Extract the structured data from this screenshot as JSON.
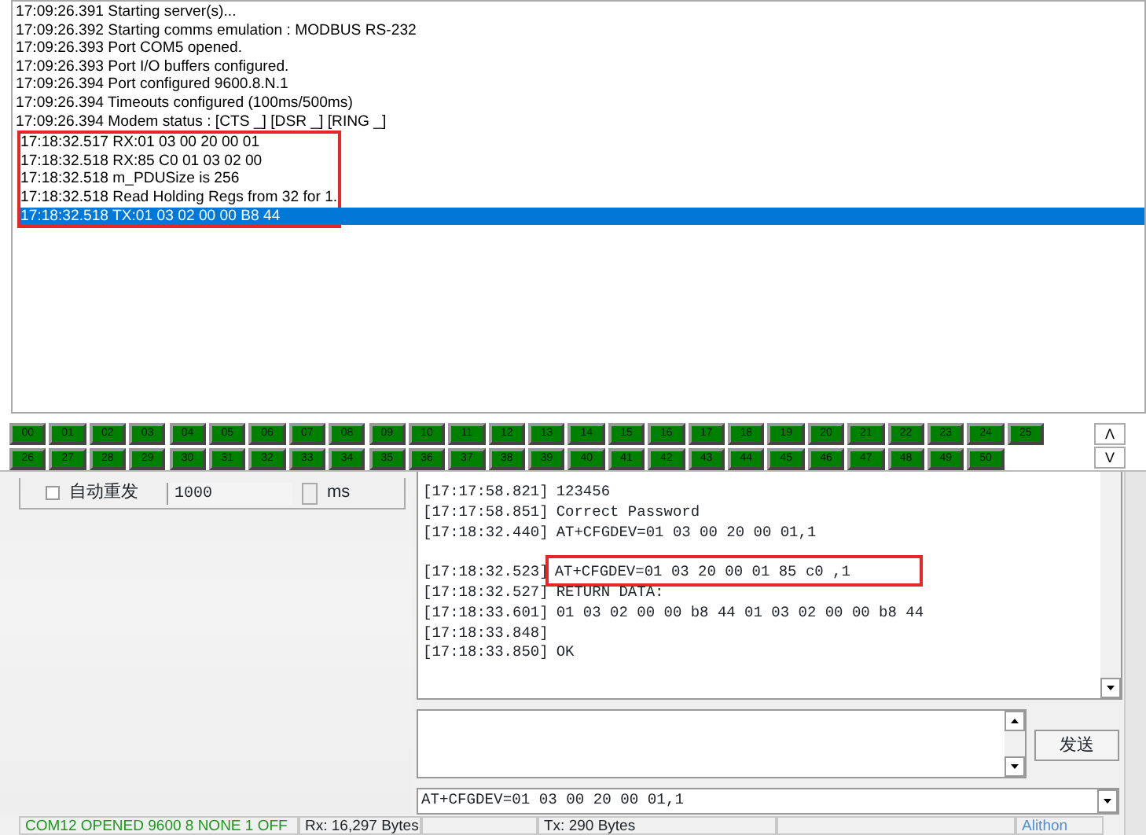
{
  "log_window": {
    "lines": [
      {
        "text": "17:09:26.391 Starting server(s)...",
        "selected": false,
        "annotated": false
      },
      {
        "text": "17:09:26.392 Starting comms emulation : MODBUS RS-232",
        "selected": false,
        "annotated": false
      },
      {
        "text": "17:09:26.393 Port COM5 opened.",
        "selected": false,
        "annotated": false
      },
      {
        "text": "17:09:26.393 Port I/O buffers configured.",
        "selected": false,
        "annotated": false
      },
      {
        "text": "17:09:26.394 Port configured 9600.8.N.1",
        "selected": false,
        "annotated": false
      },
      {
        "text": "17:09:26.394 Timeouts configured (100ms/500ms)",
        "selected": false,
        "annotated": false
      },
      {
        "text": "17:09:26.394 Modem status : [CTS _] [DSR _] [RING _]",
        "selected": false,
        "annotated": false
      },
      {
        "text": "17:18:32.517 RX:01 03 00 20 00 01",
        "selected": false,
        "annotated": true
      },
      {
        "text": "17:18:32.518 RX:85 C0 01 03 02 00",
        "selected": false,
        "annotated": true
      },
      {
        "text": "17:18:32.518 m_PDUSize is 256",
        "selected": false,
        "annotated": true
      },
      {
        "text": "17:18:32.518 Read Holding Regs from 32 for 1.",
        "selected": false,
        "annotated": true
      },
      {
        "text": "17:18:32.518 TX:01 03 02 00 00 B8 44",
        "selected": true,
        "annotated": true
      }
    ]
  },
  "registers": [
    "00",
    "01",
    "02",
    "03",
    "04",
    "05",
    "06",
    "07",
    "08",
    "09",
    "10",
    "11",
    "12",
    "13",
    "14",
    "15",
    "16",
    "17",
    "18",
    "19",
    "20",
    "21",
    "22",
    "23",
    "24",
    "25",
    "26",
    "27",
    "28",
    "29",
    "30",
    "31",
    "32",
    "33",
    "34",
    "35",
    "36",
    "37",
    "38",
    "39",
    "40",
    "41",
    "42",
    "43",
    "44",
    "45",
    "46",
    "47",
    "48",
    "49",
    "50"
  ],
  "register_scroll": [
    "Λ",
    "V"
  ],
  "auto_resend": {
    "label": "自动重发",
    "checked": false,
    "value": "1000",
    "unit": "ms"
  },
  "receive_log": [
    {
      "kind": "line",
      "time": "[17:17:58.821]",
      "text": "123456"
    },
    {
      "kind": "line",
      "time": "[17:17:58.851]",
      "text": "Correct Password"
    },
    {
      "kind": "line",
      "time": "[17:18:32.440]",
      "text": "AT+CFGDEV=01 03 00 20 00 01,1"
    },
    {
      "kind": "blank"
    },
    {
      "kind": "line",
      "time": "[17:18:32.523]",
      "text": "AT+CFGDEV=01 03 20 00 01 85 c0 ,1",
      "annotated": true
    },
    {
      "kind": "line",
      "time": "[17:18:32.527]",
      "text": "RETURN DATA:"
    },
    {
      "kind": "line",
      "time": "[17:18:33.601]",
      "text": "01 03 02 00 00 b8 44 01 03 02 00 00 b8 44"
    },
    {
      "kind": "line",
      "time": "[17:18:33.848]"
    },
    {
      "kind": "line",
      "time": "[17:18:33.850]",
      "text": "OK"
    }
  ],
  "send_button": "发送",
  "command": {
    "value": "AT+CFGDEV=01 03 00 20 00 01,1"
  },
  "status_bar": {
    "port": "COM12 OPENED  9600  8  NONE  1  OFF",
    "rx": "Rx: 16,297 Bytes",
    "tx": "Tx: 290 Bytes",
    "brand": "Alithon"
  }
}
